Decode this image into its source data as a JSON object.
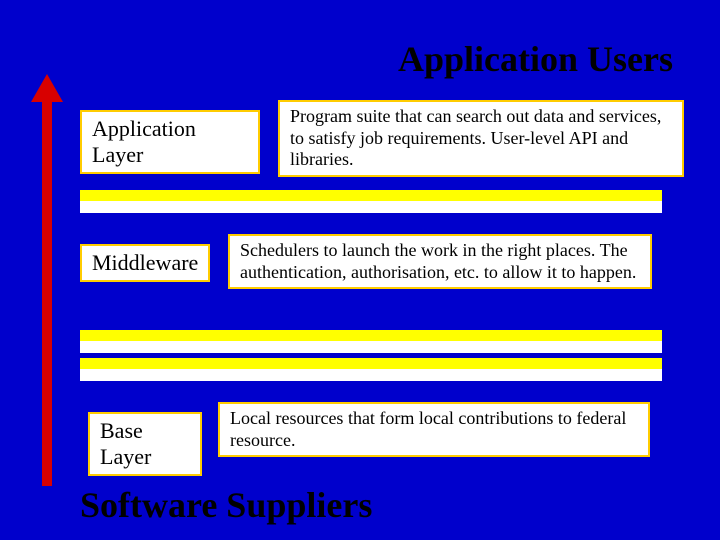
{
  "title": "Application Users",
  "footer": "Software Suppliers",
  "layers": {
    "application": {
      "label": "Application Layer",
      "description": "Program suite that can search out data and services, to satisfy job requirements. User-level API and libraries."
    },
    "middleware": {
      "label": "Middleware",
      "description": "Schedulers to launch the work in the right places. The authentication, authorisation, etc. to allow it to happen."
    },
    "base": {
      "label": "Base Layer",
      "description": "Local resources that form local contributions to federal resource."
    }
  }
}
